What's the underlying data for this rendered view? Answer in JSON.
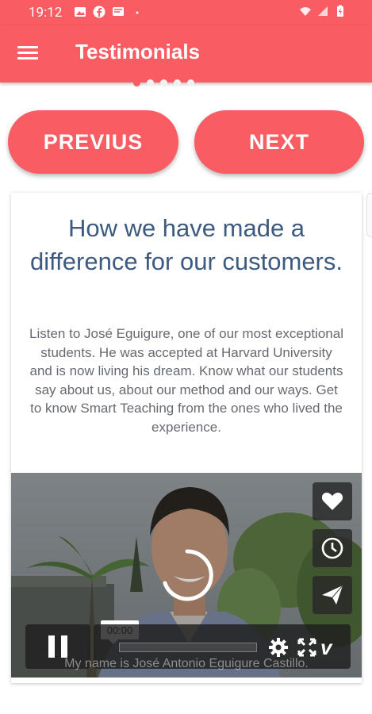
{
  "status_bar": {
    "time": "19:12",
    "left_icons": [
      "image-icon",
      "facebook-icon",
      "message-icon",
      "dot-icon"
    ],
    "right_icons": [
      "wifi-icon",
      "signal-icon",
      "battery-charging-icon"
    ]
  },
  "app_bar": {
    "title": "Testimonials",
    "menu_icon": "hamburger-menu-icon"
  },
  "pager": {
    "dot_count": 5,
    "active_index": 0
  },
  "buttons": {
    "previous_label": "PREVIUS",
    "next_label": "NEXT"
  },
  "card": {
    "heading": "How we have made a difference for our customers.",
    "body": "Listen to José Eguigure, one of our most exceptional students. He was accepted at Harvard University and is now living his dream. Know what our students say about us, about our method and our ways. Get to know Smart Teaching from the ones who lived the experience."
  },
  "video": {
    "time_tooltip": "00:00",
    "subtitle": "My name is José Antonio Eguigure Castillo.",
    "side_actions": [
      "heart-icon",
      "clock-icon",
      "send-icon"
    ],
    "brand": "v",
    "progress": 0.0
  },
  "colors": {
    "accent": "#f95c62",
    "heading": "#3d5a80",
    "body_text": "#666a70"
  }
}
